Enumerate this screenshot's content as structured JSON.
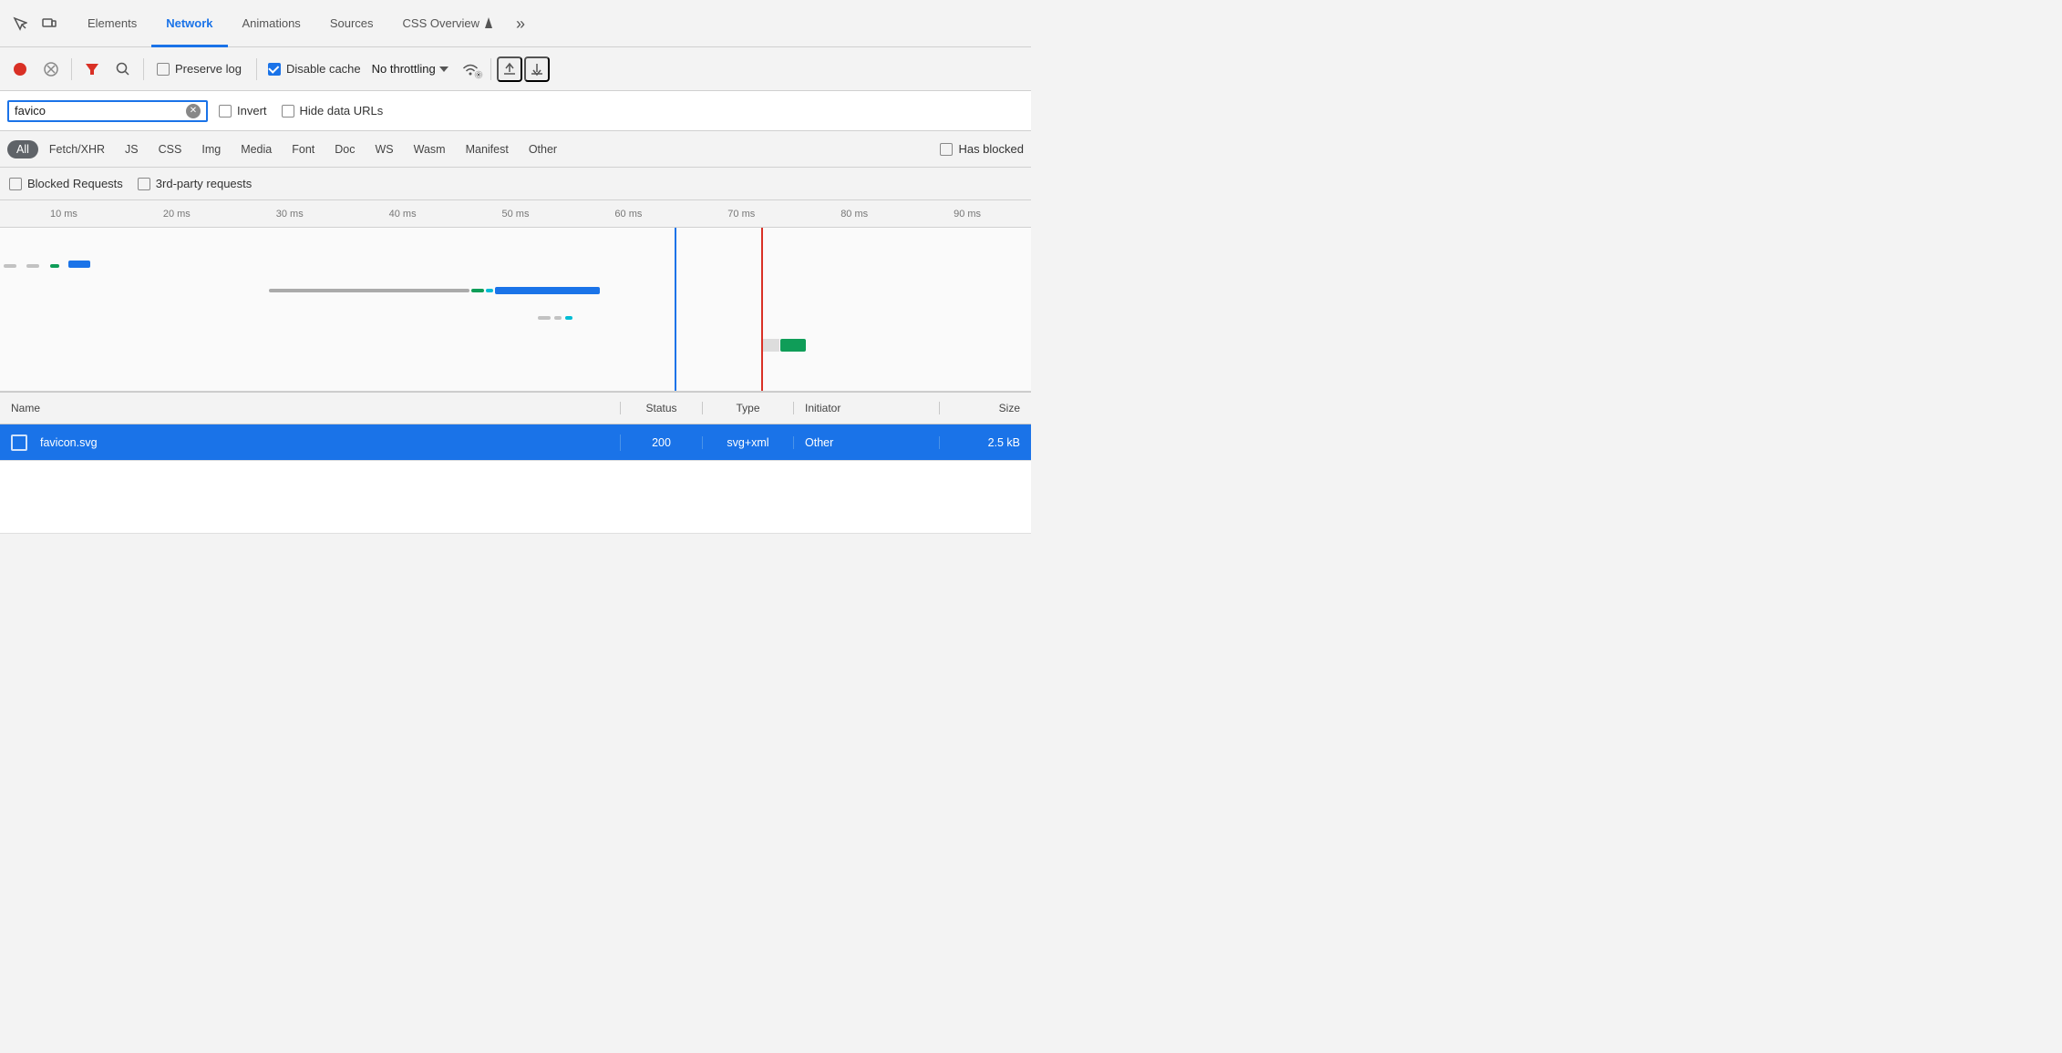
{
  "tabs": {
    "items": [
      {
        "label": "Elements",
        "active": false
      },
      {
        "label": "Network",
        "active": true
      },
      {
        "label": "Animations",
        "active": false
      },
      {
        "label": "Sources",
        "active": false
      },
      {
        "label": "CSS Overview",
        "active": false
      }
    ],
    "more_label": "»"
  },
  "toolbar": {
    "record_title": "Record network log",
    "stop_title": "Stop recording",
    "clear_title": "Clear",
    "filter_title": "Filter",
    "search_title": "Search",
    "preserve_log_label": "Preserve log",
    "preserve_log_checked": false,
    "disable_cache_label": "Disable cache",
    "disable_cache_checked": true,
    "throttle_label": "No throttling",
    "upload_title": "Import HAR file",
    "download_title": "Export HAR file"
  },
  "filter_bar": {
    "search_value": "favico",
    "search_placeholder": "Filter",
    "invert_label": "Invert",
    "invert_checked": false,
    "hide_data_urls_label": "Hide data URLs",
    "hide_data_urls_checked": false
  },
  "type_filters": {
    "items": [
      {
        "label": "All",
        "active": true
      },
      {
        "label": "Fetch/XHR",
        "active": false
      },
      {
        "label": "JS",
        "active": false
      },
      {
        "label": "CSS",
        "active": false
      },
      {
        "label": "Img",
        "active": false
      },
      {
        "label": "Media",
        "active": false
      },
      {
        "label": "Font",
        "active": false
      },
      {
        "label": "Doc",
        "active": false
      },
      {
        "label": "WS",
        "active": false
      },
      {
        "label": "Wasm",
        "active": false
      },
      {
        "label": "Manifest",
        "active": false
      },
      {
        "label": "Other",
        "active": false
      }
    ],
    "has_blocked_label": "Has blocked",
    "has_blocked_checked": false
  },
  "blocked_bar": {
    "blocked_requests_label": "Blocked Requests",
    "blocked_requests_checked": false,
    "third_party_label": "3rd-party requests",
    "third_party_checked": false
  },
  "timeline": {
    "labels": [
      "10 ms",
      "20 ms",
      "30 ms",
      "40 ms",
      "50 ms",
      "60 ms",
      "70 ms",
      "80 ms",
      "90 ms"
    ]
  },
  "table": {
    "columns": {
      "name": "Name",
      "status": "Status",
      "type": "Type",
      "initiator": "Initiator",
      "size": "Size"
    },
    "rows": [
      {
        "name": "favicon.svg",
        "status": "200",
        "type": "svg+xml",
        "initiator": "Other",
        "size": "2.5 kB",
        "selected": true
      }
    ]
  }
}
